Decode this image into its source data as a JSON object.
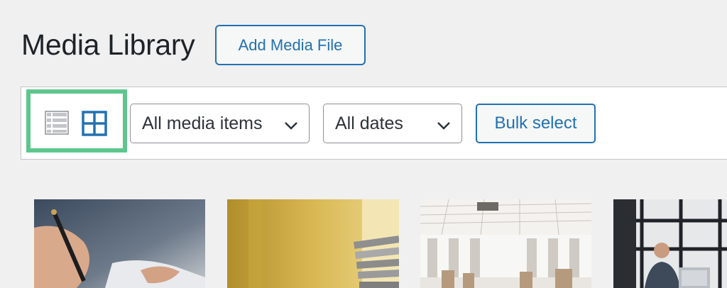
{
  "header": {
    "title": "Media Library",
    "add_button_label": "Add Media File"
  },
  "toolbar": {
    "view_modes": [
      {
        "name": "list",
        "icon": "list-view-icon",
        "active": false
      },
      {
        "name": "grid",
        "icon": "grid-view-icon",
        "active": true
      }
    ],
    "type_filter": {
      "selected": "All media items"
    },
    "date_filter": {
      "selected": "All dates"
    },
    "bulk_select_label": "Bulk select"
  },
  "colors": {
    "accent": "#2271b1",
    "highlight_border": "#5ec68c",
    "background": "#f0f0f1"
  },
  "media_items": [
    {
      "subject": "hand holding pen over paper"
    },
    {
      "subject": "stack of folders on yellow background"
    },
    {
      "subject": "office interior with chairs"
    },
    {
      "subject": "person at laptop by window"
    }
  ]
}
